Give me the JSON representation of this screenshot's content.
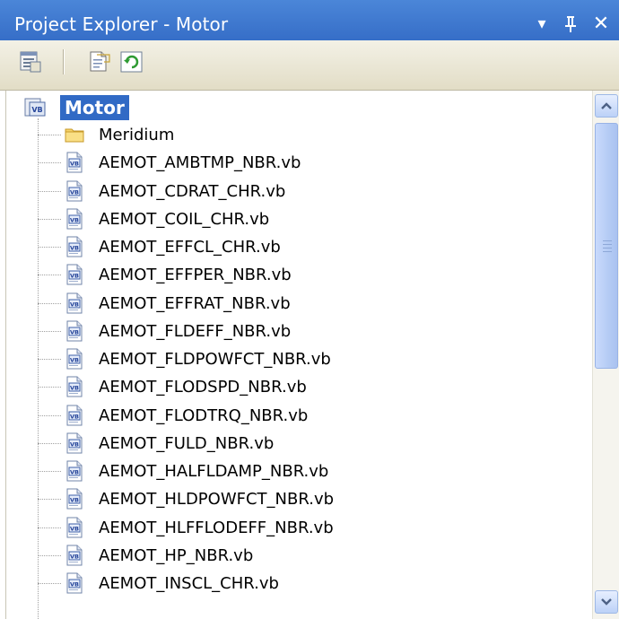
{
  "window": {
    "title": "Project Explorer - Motor",
    "dropdown_glyph": "▾",
    "pin_glyph": "ᵽ",
    "close_glyph": "✕"
  },
  "toolbar": {
    "buttons": [
      {
        "icon": "properties-icon"
      },
      {
        "icon": "view-code-icon"
      },
      {
        "icon": "refresh-icon"
      }
    ]
  },
  "tree": {
    "root": {
      "label": "Motor",
      "icon": "vb-project-icon"
    },
    "items": [
      {
        "label": "Meridium",
        "icon": "folder-icon"
      },
      {
        "label": "AEMOT_AMBTMP_NBR.vb",
        "icon": "vb-file-icon"
      },
      {
        "label": "AEMOT_CDRAT_CHR.vb",
        "icon": "vb-file-icon"
      },
      {
        "label": "AEMOT_COIL_CHR.vb",
        "icon": "vb-file-icon"
      },
      {
        "label": "AEMOT_EFFCL_CHR.vb",
        "icon": "vb-file-icon"
      },
      {
        "label": "AEMOT_EFFPER_NBR.vb",
        "icon": "vb-file-icon"
      },
      {
        "label": "AEMOT_EFFRAT_NBR.vb",
        "icon": "vb-file-icon"
      },
      {
        "label": "AEMOT_FLDEFF_NBR.vb",
        "icon": "vb-file-icon"
      },
      {
        "label": "AEMOT_FLDPOWFCT_NBR.vb",
        "icon": "vb-file-icon"
      },
      {
        "label": "AEMOT_FLODSPD_NBR.vb",
        "icon": "vb-file-icon"
      },
      {
        "label": "AEMOT_FLODTRQ_NBR.vb",
        "icon": "vb-file-icon"
      },
      {
        "label": "AEMOT_FULD_NBR.vb",
        "icon": "vb-file-icon"
      },
      {
        "label": "AEMOT_HALFLDAMP_NBR.vb",
        "icon": "vb-file-icon"
      },
      {
        "label": "AEMOT_HLDPOWFCT_NBR.vb",
        "icon": "vb-file-icon"
      },
      {
        "label": "AEMOT_HLFFLODEFF_NBR.vb",
        "icon": "vb-file-icon"
      },
      {
        "label": "AEMOT_HP_NBR.vb",
        "icon": "vb-file-icon"
      },
      {
        "label": "AEMOT_INSCL_CHR.vb",
        "icon": "vb-file-icon"
      }
    ]
  },
  "scrollbar": {
    "up_glyph": "▲",
    "down_glyph": "▼"
  }
}
